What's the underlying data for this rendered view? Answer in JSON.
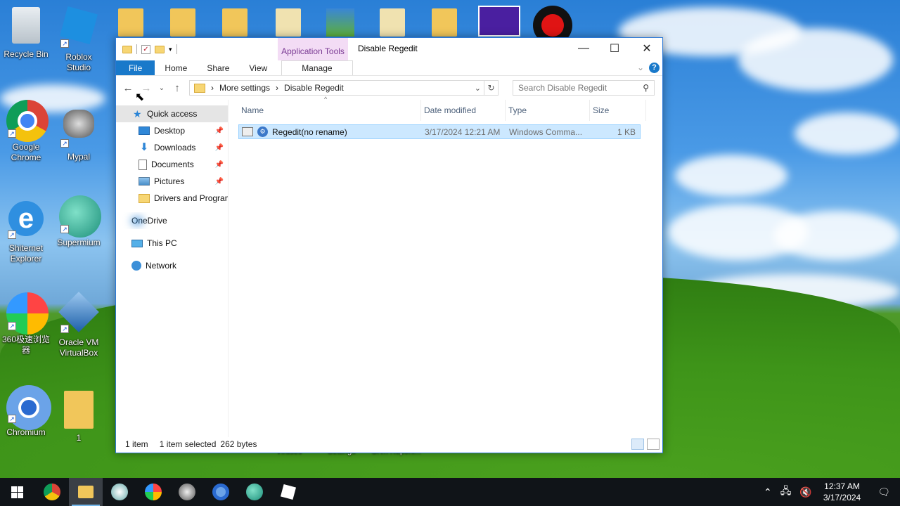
{
  "desktop": {
    "icons": [
      {
        "label": "Recycle Bin"
      },
      {
        "label": "Roblox Studio"
      },
      {
        "label": "Google Chrome"
      },
      {
        "label": "Mypal"
      },
      {
        "label": "Shiternet Explorer"
      },
      {
        "label": "Supermium"
      },
      {
        "label": "360极速浏览器"
      },
      {
        "label": "Oracle VM VirtualBox"
      },
      {
        "label": "Chromium"
      },
      {
        "label": "1"
      }
    ],
    "hidden_labels": [
      "Viruses",
      "Settings",
      "Grvn Reponi..."
    ]
  },
  "window": {
    "title": "Disable Regedit",
    "context_tab": "Application Tools",
    "controls": {
      "minimize": "—",
      "maximize": "☐",
      "close": "✕"
    },
    "ribbon_tabs": [
      "File",
      "Home",
      "Share",
      "View",
      "Manage"
    ],
    "help": "?",
    "address": {
      "crumbs": [
        "More settings",
        "Disable Regedit"
      ],
      "separator": "›"
    },
    "search": {
      "placeholder": "Search Disable Regedit"
    },
    "nav": {
      "quick_access": "Quick access",
      "items": [
        {
          "label": "Desktop",
          "icon": "desktop-icon",
          "pinned": true
        },
        {
          "label": "Downloads",
          "icon": "download-icon",
          "pinned": true
        },
        {
          "label": "Documents",
          "icon": "document-icon",
          "pinned": true
        },
        {
          "label": "Pictures",
          "icon": "pictures-icon",
          "pinned": true
        },
        {
          "label": "Drivers and Program",
          "icon": "folder-icon",
          "pinned": false
        }
      ],
      "onedrive": "OneDrive",
      "this_pc": "This PC",
      "network": "Network"
    },
    "columns": [
      "Name",
      "Date modified",
      "Type",
      "Size"
    ],
    "files": [
      {
        "name": "Regedit(no rename)",
        "date": "3/17/2024 12:21 AM",
        "type": "Windows Comma...",
        "size": "1 KB",
        "selected": true
      }
    ],
    "status": {
      "count": "1 item",
      "selection": "1 item selected",
      "bytes": "262 bytes"
    }
  },
  "taskbar": {
    "clock_time": "12:37 AM",
    "clock_date": "3/17/2024"
  },
  "colors": {
    "accent": "#1979ca",
    "selection": "#cce8ff",
    "context_tab": "#f3dcf5"
  }
}
